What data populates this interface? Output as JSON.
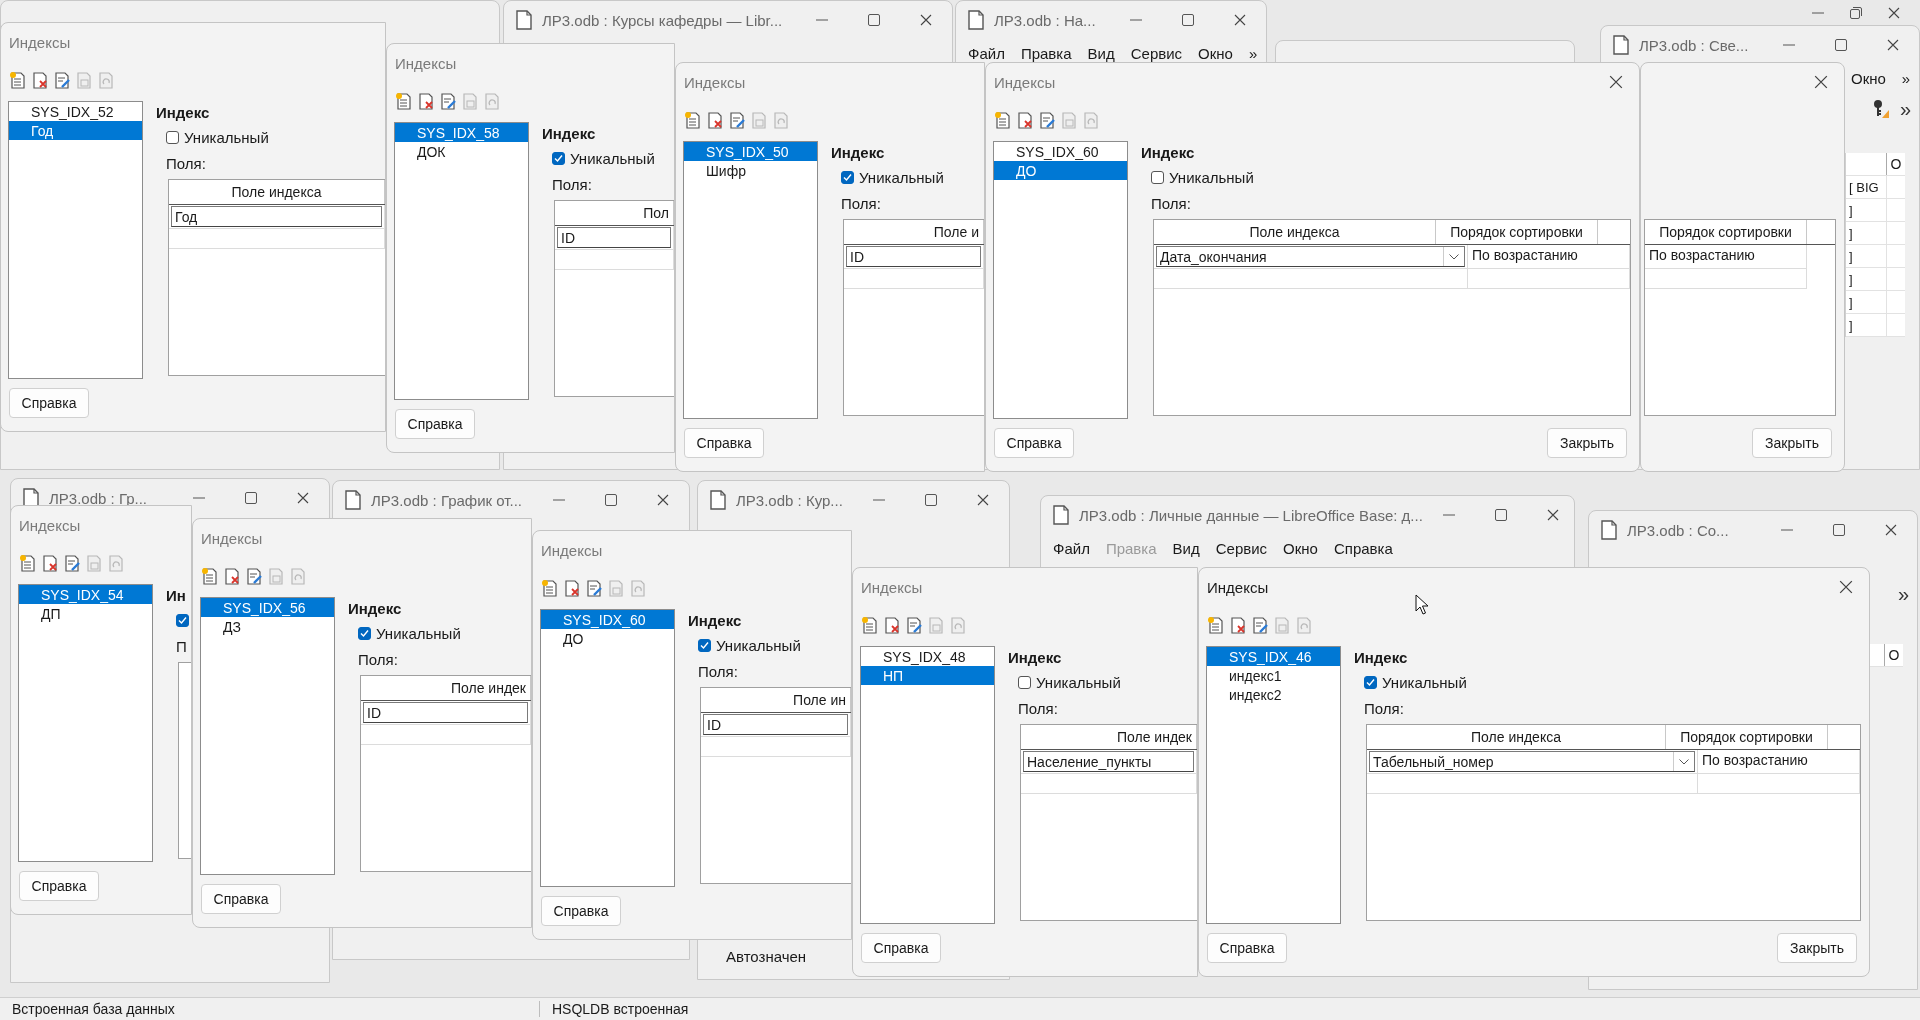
{
  "main": {
    "status_bar": [
      "Встроенная база данных",
      "HSQLDB встроенная"
    ]
  },
  "windows": [
    {
      "title": "ЛР3.odb : Курсы кафедры — Libr..."
    },
    {
      "title": "ЛР3.odb : На...",
      "menu": [
        {
          "label": "Файл",
          "disabled": false
        },
        {
          "label": "Правка",
          "disabled": false
        },
        {
          "label": "Вид",
          "disabled": false
        },
        {
          "label": "Сервис",
          "disabled": false
        },
        {
          "label": "Окно",
          "disabled": false
        },
        {
          "label": "»",
          "disabled": false
        }
      ]
    },
    {
      "title": "ЛР3.odb : Све...",
      "menu": [
        {
          "label": "Окно",
          "disabled": false
        },
        {
          "label": "»",
          "disabled": false
        }
      ],
      "chevron": "»",
      "column": {
        "header": "О",
        "cells": [
          "[ BIG",
          "]",
          "]",
          "]",
          "]",
          "]",
          "]"
        ]
      }
    },
    {
      "title": "ЛР3.odb : Гр..."
    },
    {
      "title": "ЛР3.odb : График от..."
    },
    {
      "title": "ЛР3.odb : Кур...",
      "field_label": "Автозначен"
    },
    {
      "title": "ЛР3.odb : Личные данные — LibreOffice Base: д...",
      "menu": [
        {
          "label": "Файл",
          "disabled": false
        },
        {
          "label": "Правка",
          "disabled": true
        },
        {
          "label": "Вид",
          "disabled": false
        },
        {
          "label": "Сервис",
          "disabled": false
        },
        {
          "label": "Окно",
          "disabled": false
        },
        {
          "label": "Справка",
          "disabled": false
        }
      ]
    },
    {
      "title": "ЛР3.odb : Co...",
      "chevron": "»",
      "column": {
        "header": "О"
      }
    }
  ],
  "dialogs": [
    {
      "title": "Индексы",
      "active": false,
      "tools": [
        {
          "kind": "new",
          "disabled": false
        },
        {
          "kind": "delete",
          "disabled": false
        },
        {
          "kind": "rename",
          "disabled": false
        },
        {
          "kind": "save",
          "disabled": true
        },
        {
          "kind": "reset",
          "disabled": true
        }
      ],
      "indexes": [
        {
          "label": "SYS_IDX_52",
          "selected": false
        },
        {
          "label": "Год",
          "selected": true
        }
      ],
      "heading": "Индекс",
      "unique": {
        "label": "Уникальный",
        "checked": false
      },
      "fields_label": "Поля:",
      "columns": [
        {
          "label": "Поле индекса",
          "kind": "field"
        }
      ],
      "rows": [
        [
          {
            "kind": "edit",
            "text": "Год"
          }
        ]
      ],
      "buttons": [
        {
          "label": "Справка",
          "kind": "help"
        }
      ]
    },
    {
      "title": "Индексы",
      "active": false,
      "tools": [
        {
          "kind": "new",
          "disabled": false
        },
        {
          "kind": "delete",
          "disabled": false
        },
        {
          "kind": "rename",
          "disabled": false
        },
        {
          "kind": "save",
          "disabled": true
        },
        {
          "kind": "reset",
          "disabled": true
        }
      ],
      "indexes": [
        {
          "label": "SYS_IDX_58",
          "selected": true
        },
        {
          "label": "ДОК",
          "selected": false
        }
      ],
      "heading": "Индекс",
      "unique": {
        "label": "Уникальный",
        "checked": true
      },
      "fields_label": "Поля:",
      "columns": [
        {
          "label": "Пол",
          "kind": "field"
        }
      ],
      "rows": [
        [
          {
            "kind": "edit",
            "text": "ID"
          }
        ]
      ],
      "buttons": [
        {
          "label": "Справка",
          "kind": "help"
        }
      ]
    },
    {
      "title": "Индексы",
      "active": false,
      "tools": [
        {
          "kind": "new",
          "disabled": false
        },
        {
          "kind": "delete",
          "disabled": false
        },
        {
          "kind": "rename",
          "disabled": false
        },
        {
          "kind": "save",
          "disabled": true
        },
        {
          "kind": "reset",
          "disabled": true
        }
      ],
      "indexes": [
        {
          "label": "SYS_IDX_50",
          "selected": true
        },
        {
          "label": "Шифр",
          "selected": false
        }
      ],
      "heading": "Индекс",
      "unique": {
        "label": "Уникальный",
        "checked": true
      },
      "fields_label": "Поля:",
      "columns": [
        {
          "label": "Поле и",
          "kind": "field"
        }
      ],
      "rows": [
        [
          {
            "kind": "edit",
            "text": "ID"
          }
        ]
      ],
      "buttons": [
        {
          "label": "Справка",
          "kind": "help"
        }
      ]
    },
    {
      "title": "Индексы",
      "active": false,
      "tools": [
        {
          "kind": "new",
          "disabled": false
        },
        {
          "kind": "delete",
          "disabled": false
        },
        {
          "kind": "rename",
          "disabled": false
        },
        {
          "kind": "save",
          "disabled": true
        },
        {
          "kind": "reset",
          "disabled": true
        }
      ],
      "indexes": [
        {
          "label": "SYS_IDX_60",
          "selected": false
        },
        {
          "label": "ДО",
          "selected": true
        }
      ],
      "heading": "Индекс",
      "unique": {
        "label": "Уникальный",
        "checked": false
      },
      "fields_label": "Поля:",
      "columns": [
        {
          "label": "Поле индекса",
          "kind": "field"
        },
        {
          "label": "Порядок сортировки",
          "kind": "order"
        }
      ],
      "rows": [
        [
          {
            "kind": "combo",
            "text": "Дата_окончания"
          },
          {
            "kind": "text",
            "text": "По возрастанию"
          }
        ]
      ],
      "buttons": [
        {
          "label": "Справка",
          "kind": "help"
        },
        {
          "label": "Закрыть",
          "kind": "close"
        }
      ]
    },
    {
      "columns": [
        {
          "label": "Порядок сортировки",
          "kind": "order"
        }
      ],
      "rows": [
        [
          {
            "kind": "text",
            "text": "По возрастанию"
          }
        ]
      ],
      "buttons": [
        {
          "label": "Закрыть",
          "kind": "close"
        }
      ]
    },
    {
      "title": "Индексы",
      "active": false,
      "tools": [
        {
          "kind": "new",
          "disabled": false
        },
        {
          "kind": "delete",
          "disabled": false
        },
        {
          "kind": "rename",
          "disabled": false
        },
        {
          "kind": "save",
          "disabled": true
        },
        {
          "kind": "reset",
          "disabled": true
        }
      ],
      "indexes": [
        {
          "label": "SYS_IDX_54",
          "selected": true
        },
        {
          "label": "ДП",
          "selected": false
        }
      ],
      "heading": "Ин",
      "unique": {
        "checked": true
      },
      "fields_label": "П",
      "buttons": [
        {
          "label": "Справка",
          "kind": "help"
        }
      ]
    },
    {
      "title": "Индексы",
      "active": false,
      "tools": [
        {
          "kind": "new",
          "disabled": false
        },
        {
          "kind": "delete",
          "disabled": false
        },
        {
          "kind": "rename",
          "disabled": false
        },
        {
          "kind": "save",
          "disabled": true
        },
        {
          "kind": "reset",
          "disabled": true
        }
      ],
      "indexes": [
        {
          "label": "SYS_IDX_56",
          "selected": true
        },
        {
          "label": "ДЗ",
          "selected": false
        }
      ],
      "heading": "Индекс",
      "unique": {
        "label": "Уникальный",
        "checked": true
      },
      "fields_label": "Поля:",
      "columns": [
        {
          "label": "Поле индек",
          "kind": "field"
        }
      ],
      "rows": [
        [
          {
            "kind": "edit",
            "text": "ID"
          }
        ]
      ],
      "buttons": [
        {
          "label": "Справка",
          "kind": "help"
        }
      ]
    },
    {
      "title": "Индексы",
      "active": false,
      "tools": [
        {
          "kind": "new",
          "disabled": false
        },
        {
          "kind": "delete",
          "disabled": false
        },
        {
          "kind": "rename",
          "disabled": false
        },
        {
          "kind": "save",
          "disabled": true
        },
        {
          "kind": "reset",
          "disabled": true
        }
      ],
      "indexes": [
        {
          "label": "SYS_IDX_60",
          "selected": true
        },
        {
          "label": "ДО",
          "selected": false
        }
      ],
      "heading": "Индекс",
      "unique": {
        "label": "Уникальный",
        "checked": true
      },
      "fields_label": "Поля:",
      "columns": [
        {
          "label": "Поле ин",
          "kind": "field"
        }
      ],
      "rows": [
        [
          {
            "kind": "edit",
            "text": "ID"
          }
        ]
      ],
      "buttons": [
        {
          "label": "Справка",
          "kind": "help"
        }
      ]
    },
    {
      "title": "Индексы",
      "active": false,
      "tools": [
        {
          "kind": "new",
          "disabled": false
        },
        {
          "kind": "delete",
          "disabled": false
        },
        {
          "kind": "rename",
          "disabled": false
        },
        {
          "kind": "save",
          "disabled": true
        },
        {
          "kind": "reset",
          "disabled": true
        }
      ],
      "indexes": [
        {
          "label": "SYS_IDX_48",
          "selected": false
        },
        {
          "label": "НП",
          "selected": true
        }
      ],
      "heading": "Индекс",
      "unique": {
        "label": "Уникальный",
        "checked": false
      },
      "fields_label": "Поля:",
      "columns": [
        {
          "label": "Поле индек",
          "kind": "field"
        }
      ],
      "rows": [
        [
          {
            "kind": "edit",
            "text": "Население_пункты"
          }
        ]
      ],
      "buttons": [
        {
          "label": "Справка",
          "kind": "help"
        }
      ]
    },
    {
      "title": "Индексы",
      "active": true,
      "tools": [
        {
          "kind": "new",
          "disabled": false
        },
        {
          "kind": "delete",
          "disabled": false
        },
        {
          "kind": "rename",
          "disabled": false
        },
        {
          "kind": "save",
          "disabled": true
        },
        {
          "kind": "reset",
          "disabled": true
        }
      ],
      "indexes": [
        {
          "label": "SYS_IDX_46",
          "selected": true
        },
        {
          "label": "индекс1",
          "selected": false
        },
        {
          "label": "индекс2",
          "selected": false
        }
      ],
      "heading": "Индекс",
      "unique": {
        "label": "Уникальный",
        "checked": true
      },
      "fields_label": "Поля:",
      "columns": [
        {
          "label": "Поле индекса",
          "kind": "field"
        },
        {
          "label": "Порядок сортировки",
          "kind": "order"
        }
      ],
      "rows": [
        [
          {
            "kind": "combo",
            "text": "Табельный_номер"
          },
          {
            "kind": "text",
            "text": "По возрастанию"
          }
        ]
      ],
      "buttons": [
        {
          "label": "Справка",
          "kind": "help"
        },
        {
          "label": "Закрыть",
          "kind": "close"
        }
      ]
    }
  ]
}
